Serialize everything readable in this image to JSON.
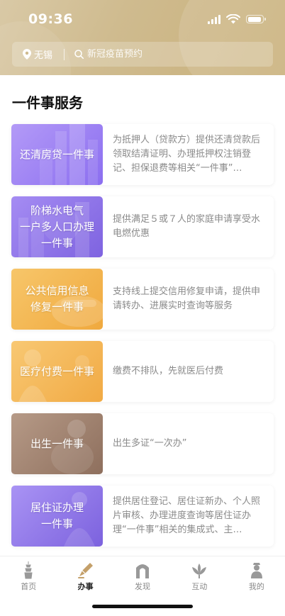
{
  "status_bar": {
    "time": "09:36"
  },
  "search": {
    "location": "无锡",
    "placeholder": "新冠疫苗预约"
  },
  "section_title": "一件事服务",
  "services": [
    {
      "title": "还清房贷一件事",
      "desc": "为抵押人（贷款方）提供还清贷款后领取结清证明、办理抵押权注销登记、担保退费等相关“一件事”…",
      "theme": "purple"
    },
    {
      "title": "阶梯水电气\n一户多人口办理\n一件事",
      "desc": "提供满足５或７人的家庭申请享受水电燃优惠",
      "theme": "violet"
    },
    {
      "title": "公共信用信息\n修复一件事",
      "desc": "支持线上提交信用修复申请，提供申请转办、进展实时查询等服务",
      "theme": "orange"
    },
    {
      "title": "医疗付费一件事",
      "desc": "缴费不排队，先就医后付费",
      "theme": "amber"
    },
    {
      "title": "出生一件事",
      "desc": "出生多证“一次办”",
      "theme": "brown"
    },
    {
      "title": "居住证办理\n一件事",
      "desc": "提供居住登记、居住证新办、个人照片审核、办理进度查询等居住证办理“一件事”相关的集成式、主…",
      "theme": "lavender"
    }
  ],
  "tabs": [
    {
      "label": "首页",
      "icon": "pagoda-icon",
      "active": false
    },
    {
      "label": "办事",
      "icon": "pen-icon",
      "active": true
    },
    {
      "label": "发现",
      "icon": "arch-icon",
      "active": false
    },
    {
      "label": "互动",
      "icon": "lotus-icon",
      "active": false
    },
    {
      "label": "我的",
      "icon": "person-icon",
      "active": false
    }
  ],
  "colors": {
    "header": "#cfbb8f",
    "purple": "#9b7ff0",
    "violet": "#8e73e6",
    "orange": "#f2b550",
    "amber": "#f4b959",
    "brown": "#a0816e",
    "lavender": "#8f78e8",
    "tab_active": "#c4a06a",
    "tab_inactive": "#999999"
  }
}
